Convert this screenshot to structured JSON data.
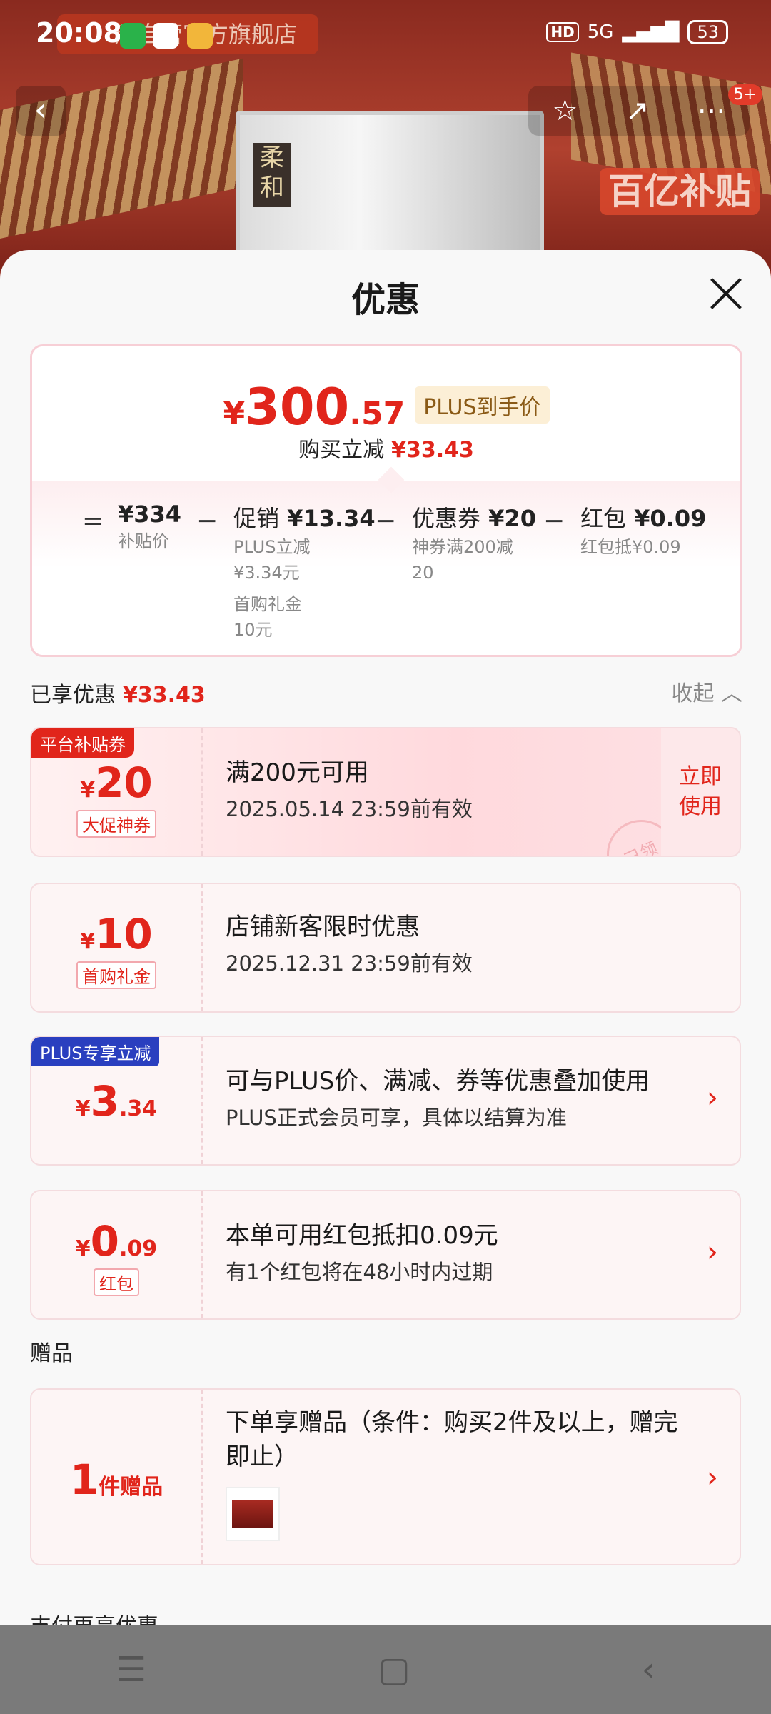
{
  "status": {
    "time": "20:08",
    "hd": "HD",
    "net": "5G",
    "battery": "53"
  },
  "background": {
    "store_name": "酒自营官方旗舰店",
    "box_label": "柔和",
    "promo": "百亿补贴",
    "badge": "5+"
  },
  "sheet": {
    "title": "优惠"
  },
  "summary": {
    "yen": "¥",
    "price_int": "300",
    "price_dec": ".57",
    "plus_tag": "PLUS到手价",
    "cut_label": "购买立减",
    "cut_value": "¥33.43",
    "eq": "=",
    "seg1": {
      "main": "¥334",
      "sub": "补贴价"
    },
    "seg2": {
      "label": "促销",
      "value": "¥13.34",
      "sub1": "PLUS立减",
      "sub2": "¥3.34元",
      "sub3": "首购礼金",
      "sub4": "10元"
    },
    "seg3": {
      "label": "优惠券",
      "value": "¥20",
      "sub1": "神券满200减",
      "sub2": "20"
    },
    "seg4": {
      "label": "红包",
      "value": "¥0.09",
      "sub1": "红包抵¥0.09"
    },
    "minus": "−"
  },
  "enjoyed": {
    "label": "已享优惠",
    "value": "¥33.43",
    "collapse": "收起"
  },
  "cards": [
    {
      "corner": "平台补贴券",
      "yen": "¥",
      "num": "20",
      "dec": "",
      "chip": "大促神券",
      "title": "满200元可用",
      "desc": "2025.05.14 23:59前有效",
      "btn": "立即使用",
      "stamp": "已领"
    },
    {
      "yen": "¥",
      "num": "10",
      "dec": "",
      "chip": "首购礼金",
      "title": "店铺新客限时优惠",
      "desc": "2025.12.31 23:59前有效"
    },
    {
      "corner": "PLUS专享立减",
      "yen": "¥",
      "num": "3",
      "dec": ".34",
      "title": "可与PLUS价、满减、券等优惠叠加使用",
      "desc": "PLUS正式会员可享，具体以结算为准"
    },
    {
      "yen": "¥",
      "num": "0",
      "dec": ".09",
      "chip": "红包",
      "title": "本单可用红包抵扣0.09元",
      "desc": "有1个红包将在48小时内过期"
    }
  ],
  "gift": {
    "section": "赠品",
    "count": "1",
    "unit": "件赠品",
    "title": "下单享赠品（条件：购买2件及以上，赠完即止）"
  },
  "pay": {
    "section": "支付再享优惠"
  },
  "colors": {
    "accent": "#e1251b",
    "plus_blue": "#2a3fbf",
    "platform_red": "#e1251b"
  }
}
